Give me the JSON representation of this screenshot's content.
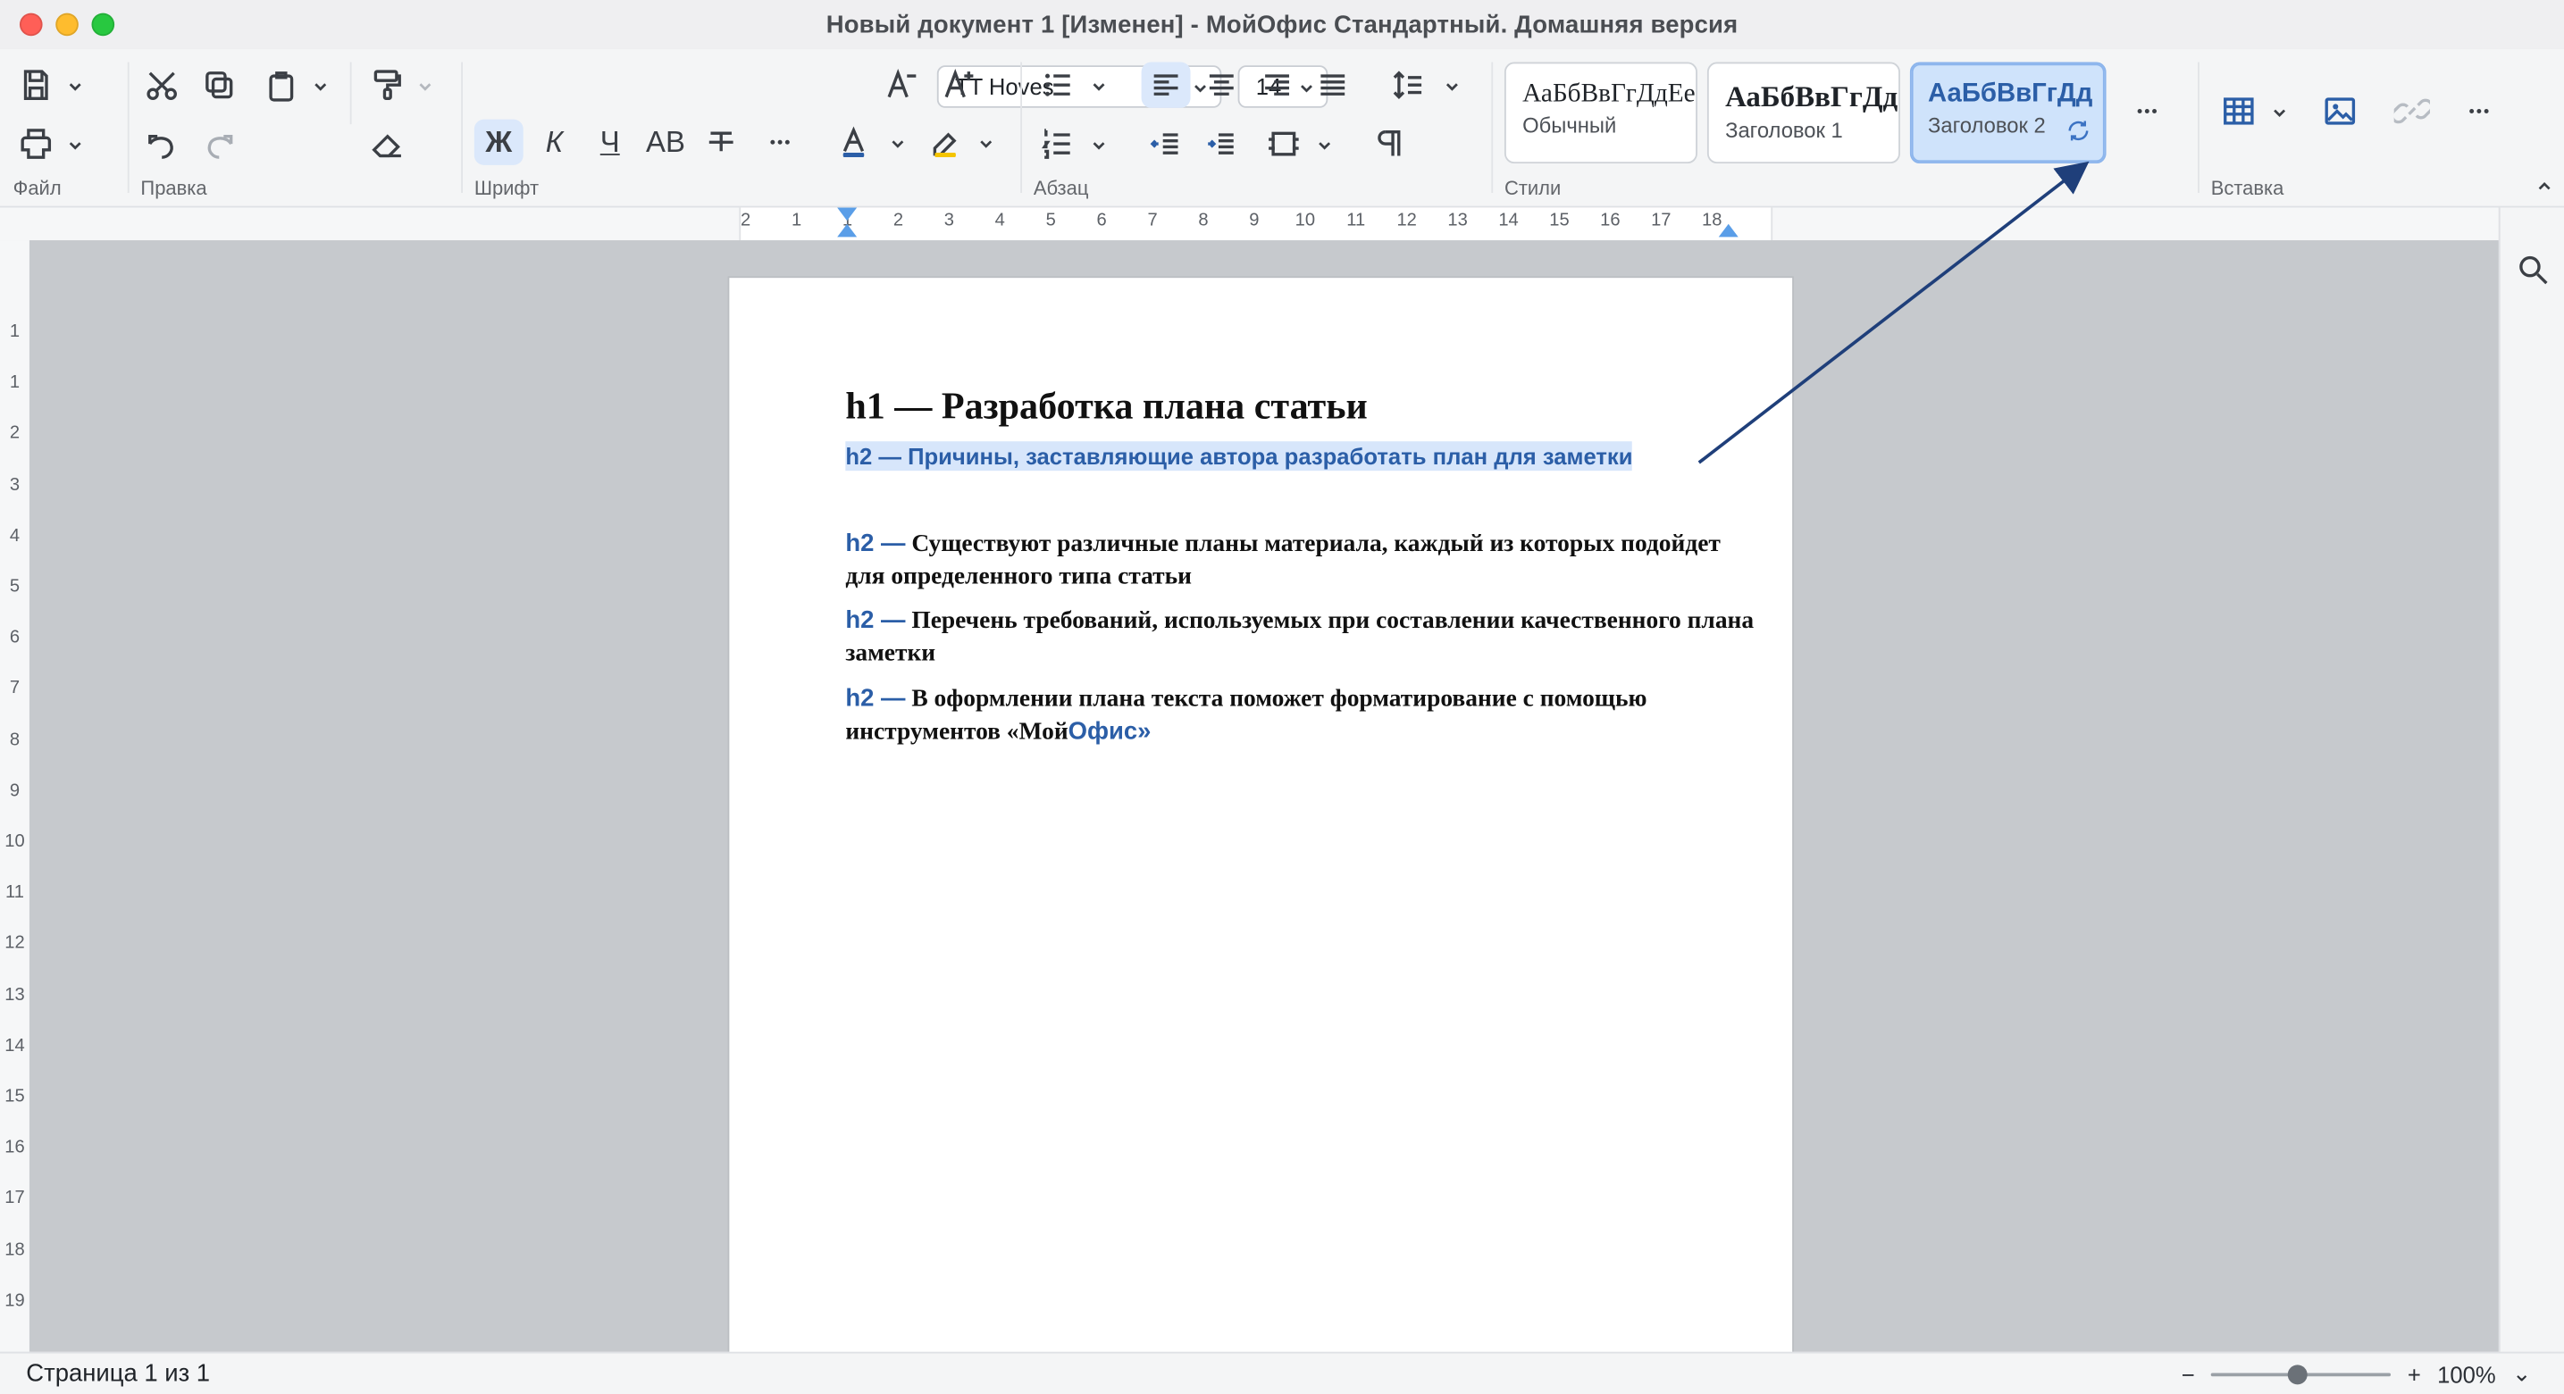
{
  "window": {
    "title": "Новый документ 1 [Изменен] - МойОфис Стандартный. Домашняя версия"
  },
  "ribbon": {
    "groups": {
      "file": "Файл",
      "edit": "Правка",
      "font": "Шрифт",
      "paragraph": "Абзац",
      "styles": "Стили",
      "insert": "Вставка"
    },
    "font": {
      "family": "TT Hoves",
      "size": "14",
      "bold": "Ж",
      "italic": "К",
      "underline": "Ч",
      "caps": "AB"
    },
    "styles": [
      {
        "preview": "АаБбВвГгДдЕе",
        "name": "Обычный"
      },
      {
        "preview": "АаБбВвГгДд",
        "name": "Заголовок 1"
      },
      {
        "preview": "АаБбВвГгДд",
        "name": "Заголовок 2"
      }
    ]
  },
  "ruler": {
    "ticks": [
      "2",
      "1",
      "1",
      "2",
      "3",
      "4",
      "5",
      "6",
      "7",
      "8",
      "9",
      "10",
      "11",
      "12",
      "13",
      "14",
      "15",
      "16",
      "17",
      "18"
    ],
    "vticks": [
      "1",
      "1",
      "2",
      "3",
      "4",
      "5",
      "6",
      "7",
      "8",
      "9",
      "10",
      "11",
      "12",
      "13",
      "14",
      "15",
      "16",
      "17",
      "18",
      "19"
    ]
  },
  "document": {
    "h1": "h1 — Разработка плана статьи",
    "h2": "h2 — Причины, заставляющие автора разработать план для заметки",
    "paras": [
      {
        "tag": "h2 —",
        "text": "Существуют различные планы материала, каждый из которых подойдет для определенного типа статьи"
      },
      {
        "tag": "h2 —",
        "text": "Перечень требований, используемых при составлении качественного плана заметки"
      },
      {
        "tag": "h2 —",
        "text": "В оформлении плана текста поможет форматирование с помощью инструментов «Мой",
        "tail": "Офис»"
      }
    ]
  },
  "status": {
    "page": "Страница 1 из 1",
    "zoom": "100%",
    "zoom_level": 0.48
  },
  "colors": {
    "accent": "#2b5ea7",
    "selection": "#d7e6fb",
    "arrow": "#1f3f7a"
  }
}
